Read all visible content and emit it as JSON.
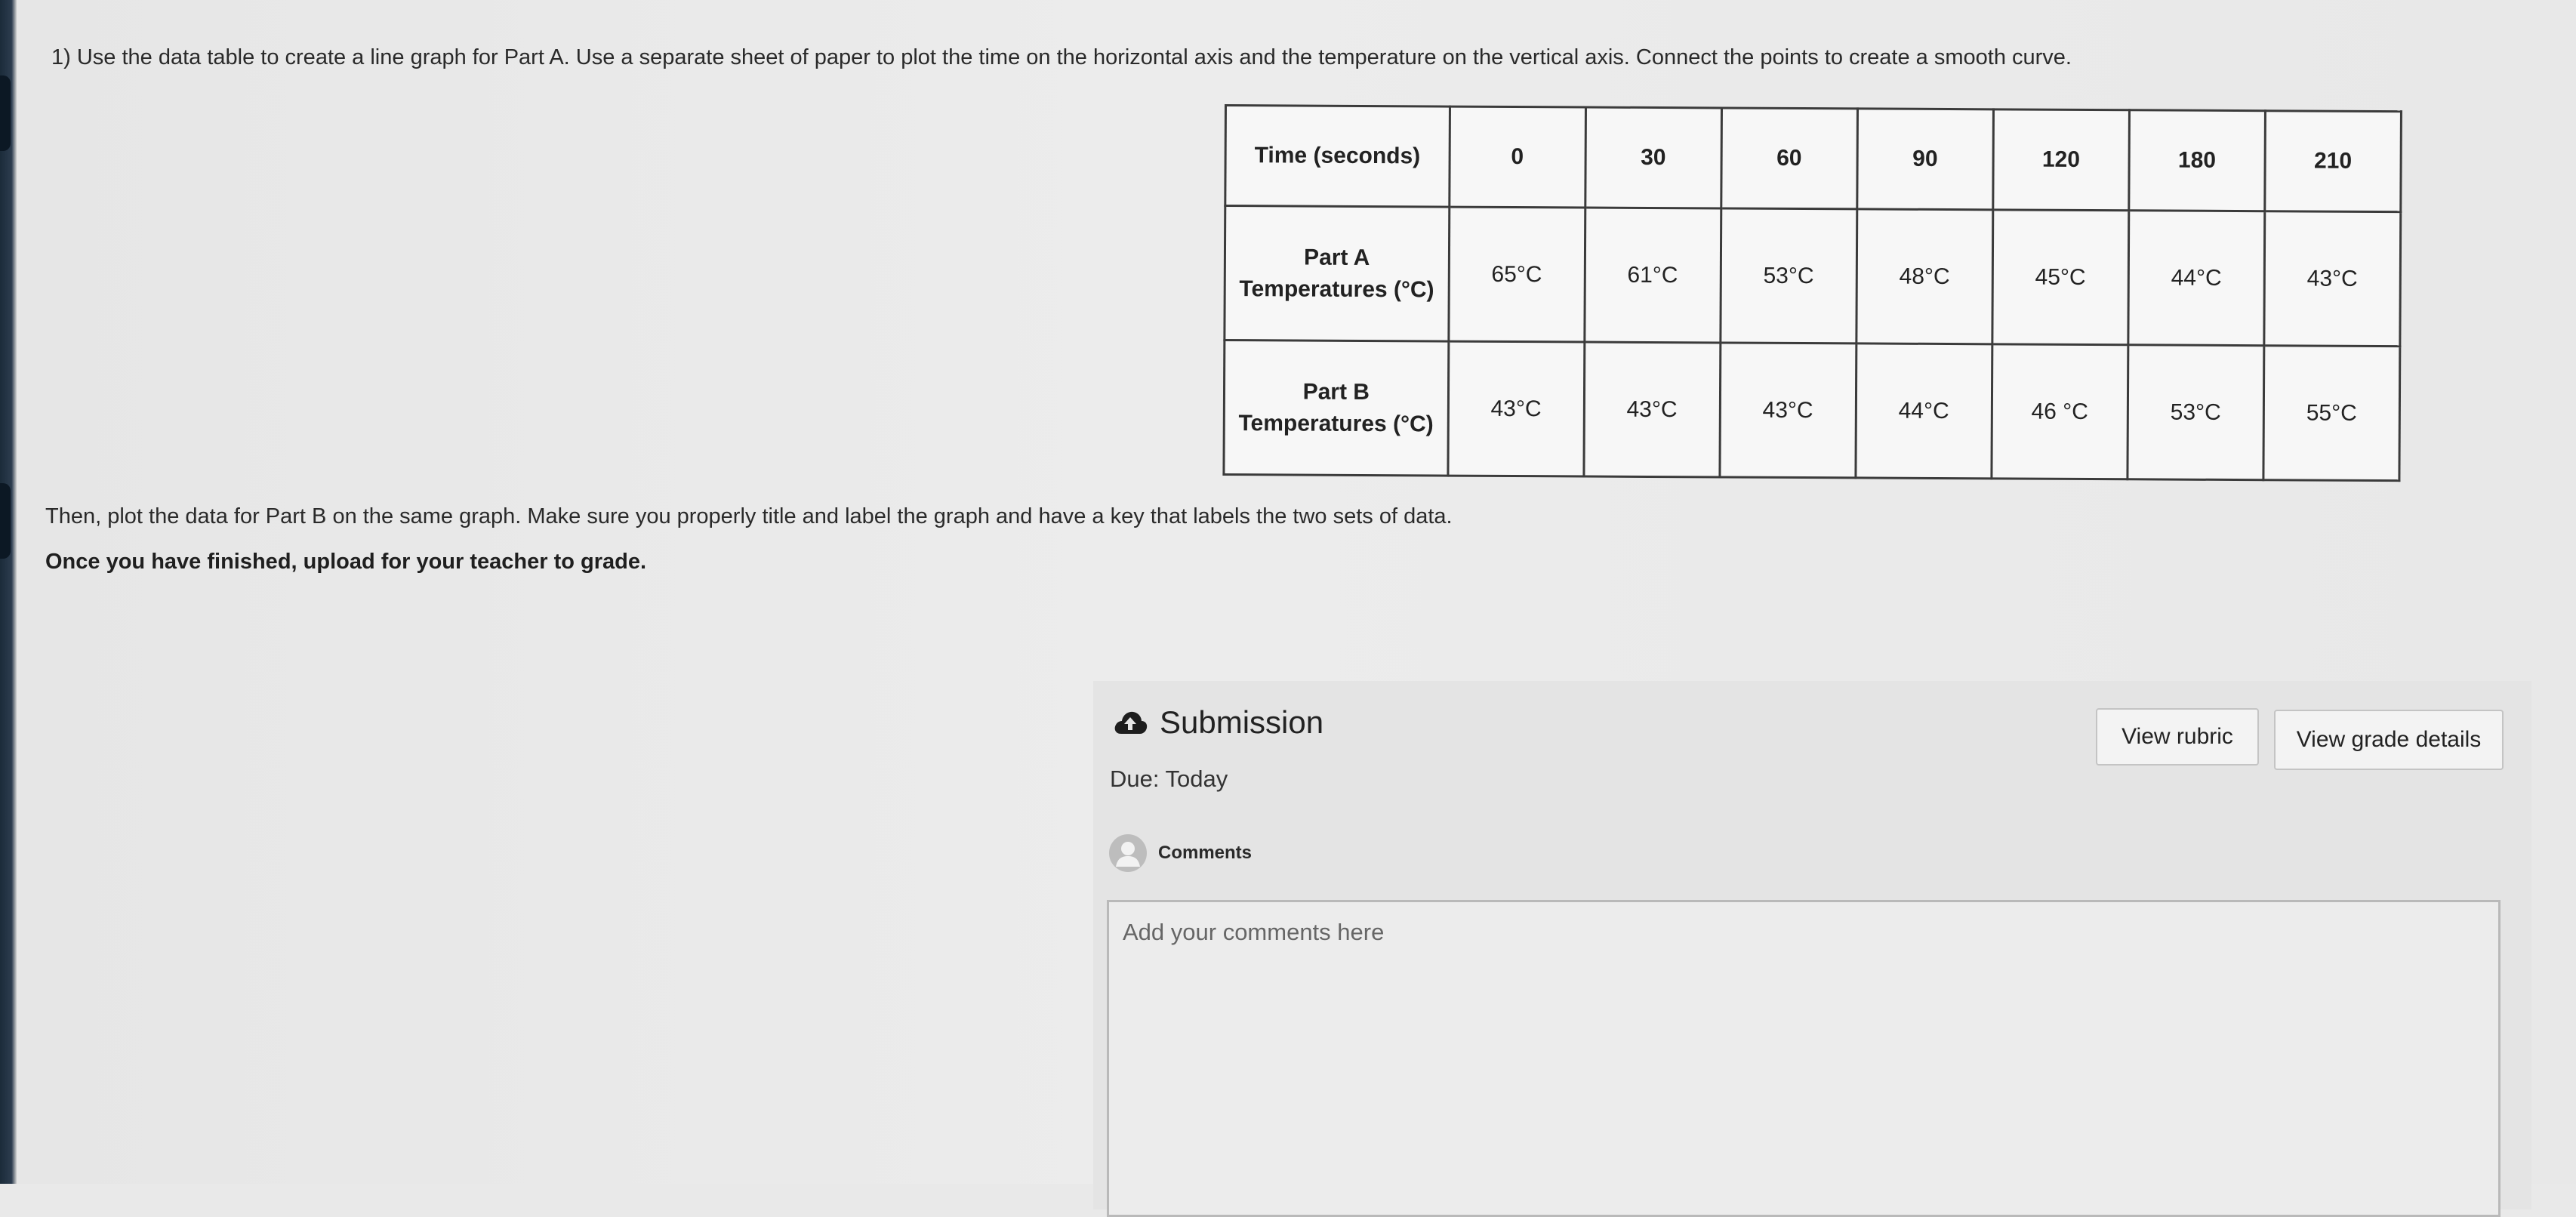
{
  "instructions": {
    "question": "1) Use the data table to create a line graph for Part A. Use a separate sheet of paper to plot the time on the horizontal axis and the temperature on the vertical axis. Connect the points to create a smooth curve.",
    "then": "Then, plot the data for Part B on the same graph. Make sure you properly title and label the graph and have a key that labels the two sets of data.",
    "finished": "Once you have finished, upload for your teacher to grade."
  },
  "table": {
    "header_label": "Time (seconds)",
    "times": [
      "0",
      "30",
      "60",
      "90",
      "120",
      "180",
      "210"
    ],
    "rows": [
      {
        "label_line1": "Part A",
        "label_line2": "Temperatures (°C)",
        "values": [
          "65°C",
          "61°C",
          "53°C",
          "48°C",
          "45°C",
          "44°C",
          "43°C"
        ]
      },
      {
        "label_line1": "Part B",
        "label_line2": "Temperatures (°C)",
        "values": [
          "43°C",
          "43°C",
          "43°C",
          "44°C",
          "46 °C",
          "53°C",
          "55°C"
        ]
      }
    ]
  },
  "submission": {
    "title": "Submission",
    "icon": "upload-cloud-icon",
    "due": "Due: Today",
    "comments_label": "Comments",
    "comment_placeholder": "Add your comments here",
    "view_rubric": "View rubric",
    "view_grade_details": "View grade details"
  }
}
